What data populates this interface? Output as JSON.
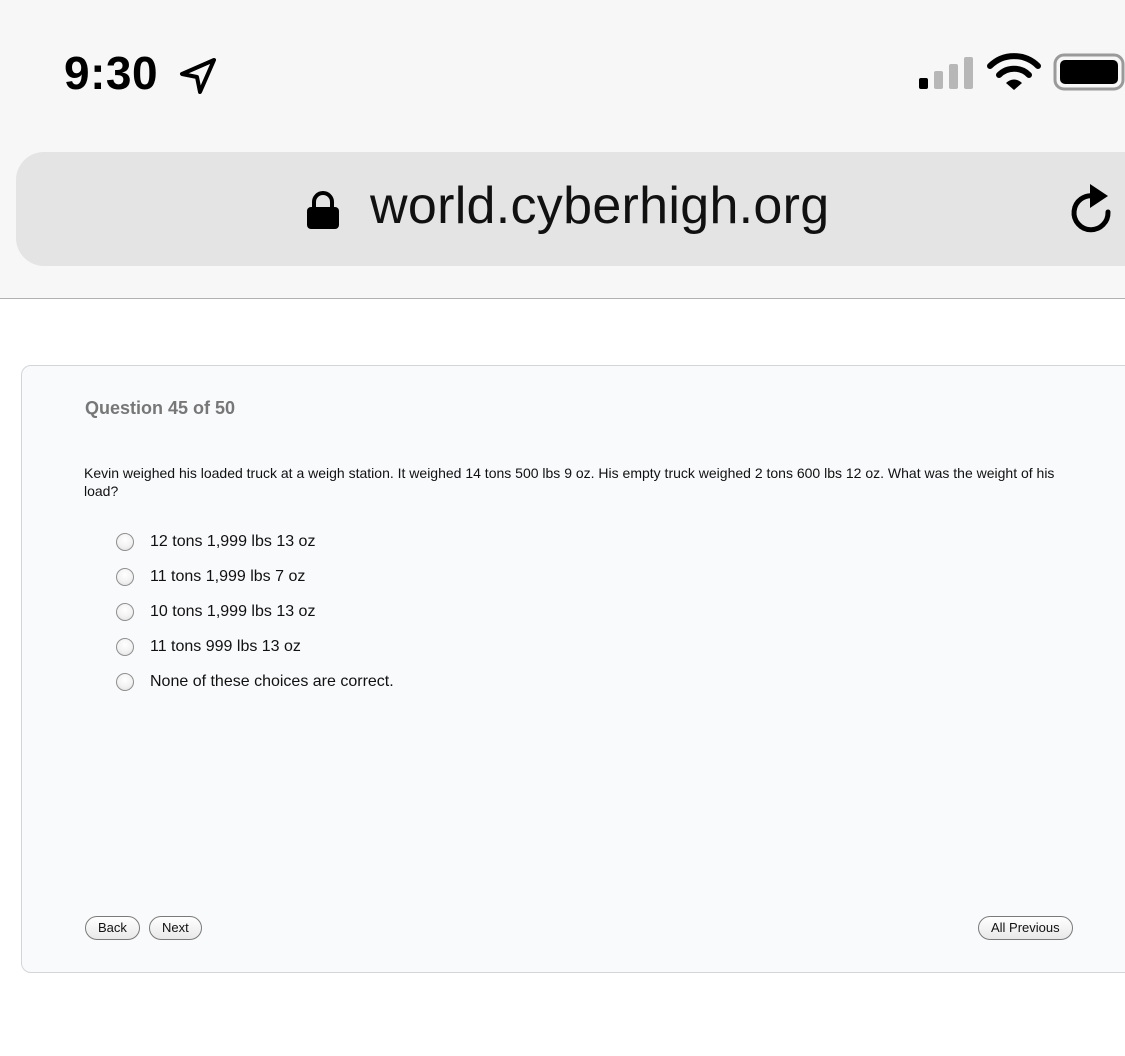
{
  "status_bar": {
    "time": "9:30",
    "icons": [
      "location-arrow-icon",
      "signal-icon",
      "wifi-icon",
      "battery-icon"
    ]
  },
  "address_bar": {
    "url": "world.cyberhigh.org",
    "icons": [
      "lock-icon",
      "reload-icon"
    ]
  },
  "quiz": {
    "counter": "Question 45 of 50",
    "question": "Kevin weighed his loaded truck at a weigh station. It weighed 14 tons 500 lbs 9 oz. His empty truck weighed 2 tons 600 lbs 12 oz. What was the weight of his load?",
    "choices": [
      {
        "label": "12 tons 1,999 lbs 13 oz",
        "selected": false
      },
      {
        "label": "11 tons 1,999 lbs 7 oz",
        "selected": false
      },
      {
        "label": "10 tons 1,999 lbs 13 oz",
        "selected": false
      },
      {
        "label": "11 tons 999 lbs 13 oz",
        "selected": false
      },
      {
        "label": "None of these choices are correct.",
        "selected": false
      }
    ],
    "buttons": {
      "back": "Back",
      "next": "Next",
      "all_previous": "All Previous"
    }
  },
  "colors": {
    "chrome_bg": "#f7f7f7",
    "url_bar_bg": "#e4e4e5",
    "card_bg": "#f9fafc",
    "counter_text": "#777777"
  }
}
